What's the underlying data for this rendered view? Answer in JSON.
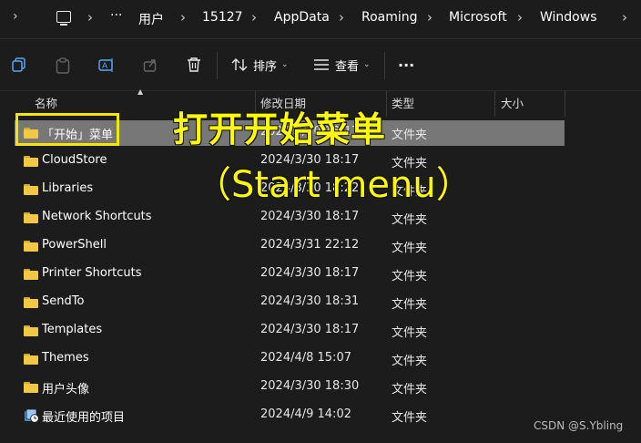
{
  "breadcrumb": {
    "ellipsis": "···",
    "items": [
      "用户",
      "15127",
      "AppData",
      "Roaming",
      "Microsoft",
      "Windows"
    ]
  },
  "toolbar": {
    "sort_label": "排序",
    "view_label": "查看",
    "more_label": "···"
  },
  "columns": {
    "name": "名称",
    "modified": "修改日期",
    "type": "类型",
    "size": "大小"
  },
  "rows": [
    {
      "name": "「开始」菜单",
      "date": "2024/3/30 18:17",
      "type": "文件夹"
    },
    {
      "name": "CloudStore",
      "date": "2024/3/30 18:17",
      "type": "文件夹"
    },
    {
      "name": "Libraries",
      "date": "2024/3/30 18:22",
      "type": "文件夹"
    },
    {
      "name": "Network Shortcuts",
      "date": "2024/3/30 18:17",
      "type": "文件夹"
    },
    {
      "name": "PowerShell",
      "date": "2024/3/31 22:12",
      "type": "文件夹"
    },
    {
      "name": "Printer Shortcuts",
      "date": "2024/3/30 18:17",
      "type": "文件夹"
    },
    {
      "name": "SendTo",
      "date": "2024/3/30 18:31",
      "type": "文件夹"
    },
    {
      "name": "Templates",
      "date": "2024/3/30 18:17",
      "type": "文件夹"
    },
    {
      "name": "Themes",
      "date": "2024/4/8 15:07",
      "type": "文件夹"
    },
    {
      "name": "用户头像",
      "date": "2024/3/30 18:30",
      "type": "文件夹"
    },
    {
      "name": "最近使用的项目",
      "date": "2024/4/9 14:02",
      "type": "文件夹"
    }
  ],
  "annotation": {
    "title": "打开开始菜单",
    "subtitle": "（Start menu）"
  },
  "watermark": "CSDN @S.Ybling",
  "colors": {
    "highlight": "#fffd00",
    "folder": "#f2c744",
    "background": "#1c1c1c",
    "selected_row": "#777777"
  }
}
